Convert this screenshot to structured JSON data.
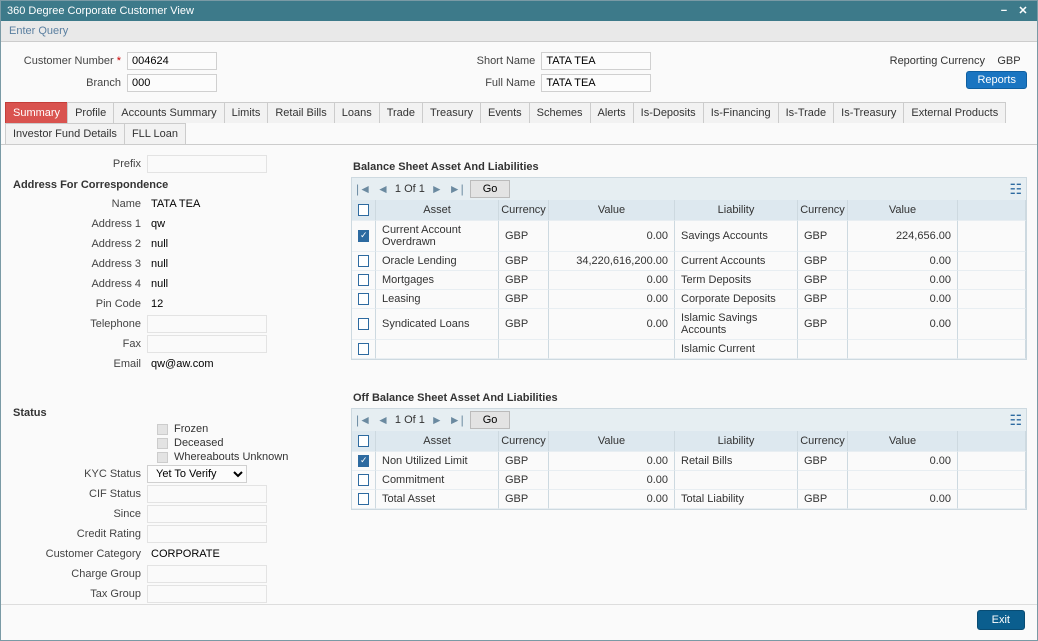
{
  "window": {
    "title": "360 Degree Corporate Customer View"
  },
  "subbar": {
    "enter_query": "Enter Query"
  },
  "topform": {
    "customer_number_label": "Customer Number",
    "customer_number": "004624",
    "branch_label": "Branch",
    "branch": "000",
    "short_name_label": "Short Name",
    "short_name": "TATA TEA",
    "full_name_label": "Full Name",
    "full_name": "TATA TEA",
    "reporting_currency_label": "Reporting Currency",
    "reporting_currency": "GBP",
    "reports_button": "Reports"
  },
  "tabs": [
    "Summary",
    "Profile",
    "Accounts Summary",
    "Limits",
    "Retail Bills",
    "Loans",
    "Trade",
    "Treasury",
    "Events",
    "Schemes",
    "Alerts",
    "Is-Deposits",
    "Is-Financing",
    "Is-Trade",
    "Is-Treasury",
    "External Products",
    "Investor Fund Details",
    "FLL Loan"
  ],
  "active_tab": "Summary",
  "left": {
    "prefix_label": "Prefix",
    "prefix": "",
    "addr_section": "Address For Correspondence",
    "name_label": "Name",
    "name": "TATA TEA",
    "a1_label": "Address 1",
    "a1": "qw",
    "a2_label": "Address 2",
    "a2": "null",
    "a3_label": "Address 3",
    "a3": "null",
    "a4_label": "Address 4",
    "a4": "null",
    "pin_label": "Pin Code",
    "pin": "12",
    "tel_label": "Telephone",
    "tel": "",
    "fax_label": "Fax",
    "fax": "",
    "email_label": "Email",
    "email": "qw@aw.com"
  },
  "status": {
    "section": "Status",
    "frozen": "Frozen",
    "deceased": "Deceased",
    "whereabouts": "Whereabouts Unknown",
    "kyc_label": "KYC Status",
    "kyc": "Yet To Verify",
    "cif_label": "CIF Status",
    "cif": "",
    "since_label": "Since",
    "since": "",
    "credit_label": "Credit Rating",
    "credit": "",
    "cat_label": "Customer Category",
    "cat": "CORPORATE",
    "charge_label": "Charge Group",
    "charge": "",
    "tax_label": "Tax Group",
    "tax": ""
  },
  "grid1": {
    "title": "Balance Sheet Asset And Liabilities",
    "page": "1 Of 1",
    "go": "Go",
    "cols": {
      "asset": "Asset",
      "cur": "Currency",
      "val": "Value",
      "liab": "Liability",
      "cur2": "Currency",
      "val2": "Value"
    },
    "rows": [
      {
        "chk": true,
        "asset": "Current Account Overdrawn",
        "cur": "GBP",
        "val": "0.00",
        "liab": "Savings Accounts",
        "cur2": "GBP",
        "val2": "224,656.00"
      },
      {
        "chk": false,
        "asset": "Oracle Lending",
        "cur": "GBP",
        "val": "34,220,616,200.00",
        "liab": "Current Accounts",
        "cur2": "GBP",
        "val2": "0.00"
      },
      {
        "chk": false,
        "asset": "Mortgages",
        "cur": "GBP",
        "val": "0.00",
        "liab": "Term Deposits",
        "cur2": "GBP",
        "val2": "0.00"
      },
      {
        "chk": false,
        "asset": "Leasing",
        "cur": "GBP",
        "val": "0.00",
        "liab": "Corporate Deposits",
        "cur2": "GBP",
        "val2": "0.00"
      },
      {
        "chk": false,
        "asset": "Syndicated Loans",
        "cur": "GBP",
        "val": "0.00",
        "liab": "Islamic Savings Accounts",
        "cur2": "GBP",
        "val2": "0.00"
      },
      {
        "chk": false,
        "asset": "",
        "cur": "",
        "val": "",
        "liab": "Islamic Current",
        "cur2": "",
        "val2": ""
      }
    ]
  },
  "grid2": {
    "title": "Off Balance Sheet Asset And Liabilities",
    "page": "1 Of 1",
    "go": "Go",
    "cols": {
      "asset": "Asset",
      "cur": "Currency",
      "val": "Value",
      "liab": "Liability",
      "cur2": "Currency",
      "val2": "Value"
    },
    "rows": [
      {
        "chk": true,
        "asset": "Non Utilized Limit",
        "cur": "GBP",
        "val": "0.00",
        "liab": "Retail Bills",
        "cur2": "GBP",
        "val2": "0.00"
      },
      {
        "chk": false,
        "asset": "Commitment",
        "cur": "GBP",
        "val": "0.00",
        "liab": "",
        "cur2": "",
        "val2": ""
      },
      {
        "chk": false,
        "asset": "Total Asset",
        "cur": "GBP",
        "val": "0.00",
        "liab": "Total Liability",
        "cur2": "GBP",
        "val2": "0.00"
      }
    ]
  },
  "footer": {
    "exit": "Exit"
  }
}
